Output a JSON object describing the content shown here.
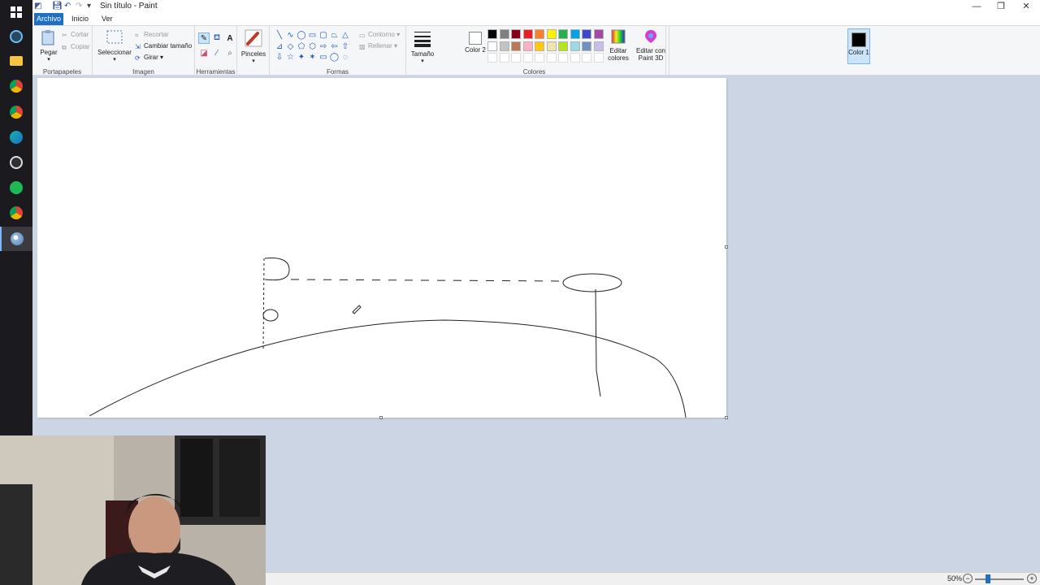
{
  "window": {
    "title": "Sin título - Paint",
    "controls": {
      "minimize": "—",
      "maximize": "❐",
      "close": "✕"
    }
  },
  "tabs": [
    {
      "label": "Archivo"
    },
    {
      "label": "Inicio"
    },
    {
      "label": "Ver"
    }
  ],
  "ribbon": {
    "portapapeles": {
      "label": "Portapapeles",
      "paste": "Pegar",
      "cut": "Cortar",
      "copy": "Copiar"
    },
    "imagen": {
      "label": "Imagen",
      "select": "Seleccionar",
      "crop": "Recortar",
      "resize": "Cambiar tamaño",
      "rotate": "Girar"
    },
    "herramientas": {
      "label": "Herramientas"
    },
    "pinceles": {
      "label": "Pinceles"
    },
    "formas": {
      "label": "Formas",
      "outline": "Contorno",
      "fill": "Rellenar"
    },
    "tamano": {
      "label": "Tamaño"
    },
    "colores": {
      "label": "Colores",
      "color1": "Color 1",
      "color2": "Color 2",
      "edit": "Editar colores",
      "paint3d": "Editar con Paint 3D",
      "color1_value": "#000000",
      "color2_value": "#ffffff",
      "palette_row1": [
        "#000000",
        "#7f7f7f",
        "#880015",
        "#ed1c24",
        "#ff7f27",
        "#fff200",
        "#22b14c",
        "#00a2e8",
        "#3f48cc",
        "#a349a4"
      ],
      "palette_row2": [
        "#ffffff",
        "#c3c3c3",
        "#b97a57",
        "#ffaec9",
        "#ffc90e",
        "#efe4b0",
        "#b5e61d",
        "#99d9ea",
        "#7092be",
        "#c8bfe7"
      ]
    }
  },
  "status": {
    "zoom": "50%",
    "zoom_out": "−",
    "zoom_in": "+",
    "zoom_level": 0.22
  },
  "icons": {
    "taskbar": [
      "windows-start-icon",
      "steam-icon",
      "file-explorer-icon",
      "chrome-icon",
      "chrome-alt-icon",
      "edge-icon",
      "obs-icon",
      "spotify-icon",
      "chrome-profile-icon",
      "paint-icon"
    ]
  }
}
